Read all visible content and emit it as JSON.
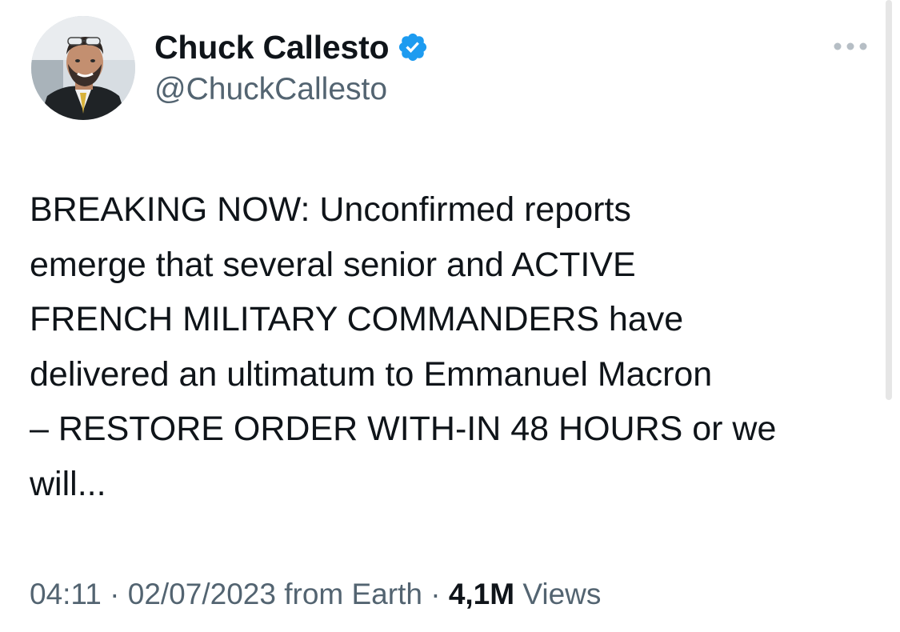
{
  "author": {
    "display_name": "Chuck Callesto",
    "handle": "@ChuckCallesto",
    "verified": true,
    "verified_color": "#1d9bf0"
  },
  "tweet": {
    "text_lines": [
      "BREAKING NOW: Unconfirmed reports",
      "emerge that several senior and ACTIVE",
      "FRENCH MILITARY COMMANDERS have",
      "delivered an ultimatum to Emmanuel Macron",
      "– RESTORE ORDER WITH-IN 48 HOURS or we",
      "will..."
    ]
  },
  "meta": {
    "time": "04:11",
    "separator": "·",
    "date": "02/07/2023",
    "source": "from Earth",
    "views_count": "4,1M",
    "views_label": "Views"
  },
  "icons": {
    "more": "more-horizontal-icon",
    "verified": "verified-badge-icon"
  },
  "colors": {
    "text": "#0f1419",
    "secondary": "#536471",
    "accent": "#1d9bf0"
  }
}
